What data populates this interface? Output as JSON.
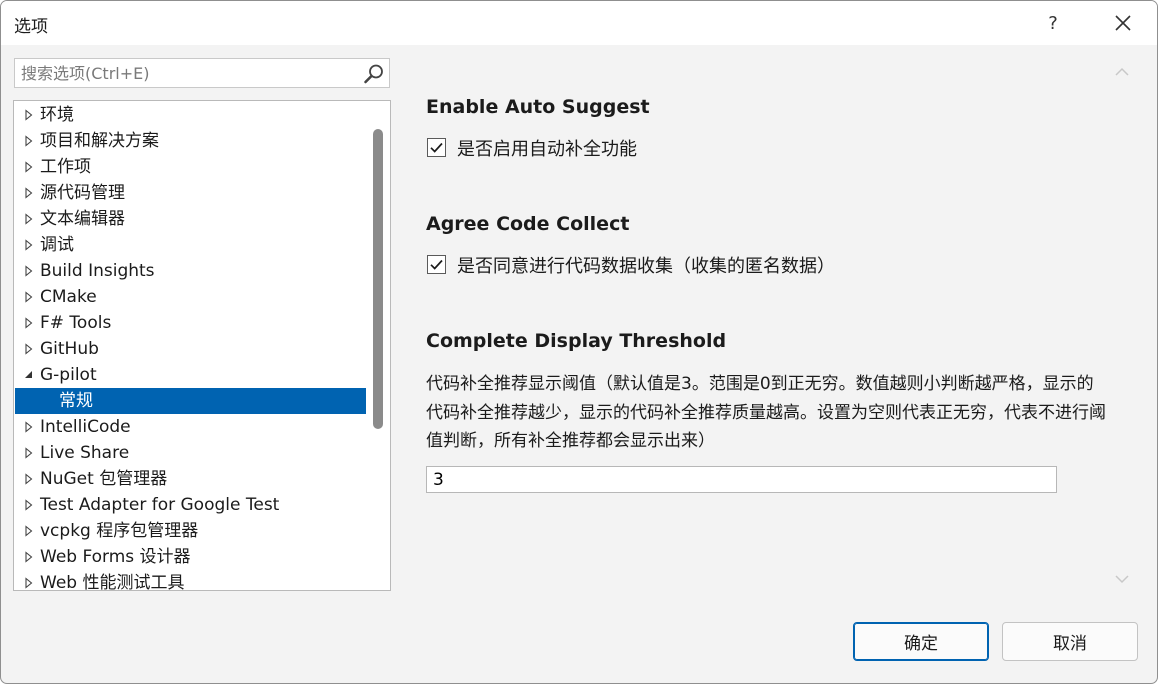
{
  "window": {
    "title": "选项"
  },
  "titlebar": {
    "help_label": "?"
  },
  "search": {
    "placeholder": "搜索选项(Ctrl+E)",
    "value": ""
  },
  "tree": {
    "items": [
      {
        "label": "环境",
        "expanded": false
      },
      {
        "label": "项目和解决方案",
        "expanded": false
      },
      {
        "label": "工作项",
        "expanded": false
      },
      {
        "label": "源代码管理",
        "expanded": false
      },
      {
        "label": "文本编辑器",
        "expanded": false
      },
      {
        "label": "调试",
        "expanded": false
      },
      {
        "label": "Build Insights",
        "expanded": false
      },
      {
        "label": "CMake",
        "expanded": false
      },
      {
        "label": "F# Tools",
        "expanded": false
      },
      {
        "label": "GitHub",
        "expanded": false
      },
      {
        "label": "G-pilot",
        "expanded": true
      },
      {
        "label": "常规",
        "child": true,
        "selected": true
      },
      {
        "label": "IntelliCode",
        "expanded": false
      },
      {
        "label": "Live Share",
        "expanded": false
      },
      {
        "label": "NuGet 包管理器",
        "expanded": false
      },
      {
        "label": "Test Adapter for Google Test",
        "expanded": false
      },
      {
        "label": "vcpkg 程序包管理器",
        "expanded": false
      },
      {
        "label": "Web Forms 设计器",
        "expanded": false
      },
      {
        "label": "Web 性能测试工具",
        "expanded": false
      }
    ]
  },
  "settings": {
    "auto_suggest": {
      "title": "Enable Auto Suggest",
      "checkbox_label": "是否启用自动补全功能",
      "checked": true
    },
    "code_collect": {
      "title": "Agree Code Collect",
      "checkbox_label": "是否同意进行代码数据收集（收集的匿名数据）",
      "checked": true
    },
    "threshold": {
      "title": "Complete Display Threshold",
      "description": "代码补全推荐显示阈值（默认值是3。范围是0到正无穷。数值越则小判断越严格，显示的代码补全推荐越少，显示的代码补全推荐质量越高。设置为空则代表正无穷，代表不进行阈值判断，所有补全推荐都会显示出来）",
      "value": "3"
    }
  },
  "footer": {
    "ok_label": "确定",
    "cancel_label": "取消"
  },
  "colors": {
    "selection": "#0063b1",
    "accent_border": "#0063b1"
  }
}
